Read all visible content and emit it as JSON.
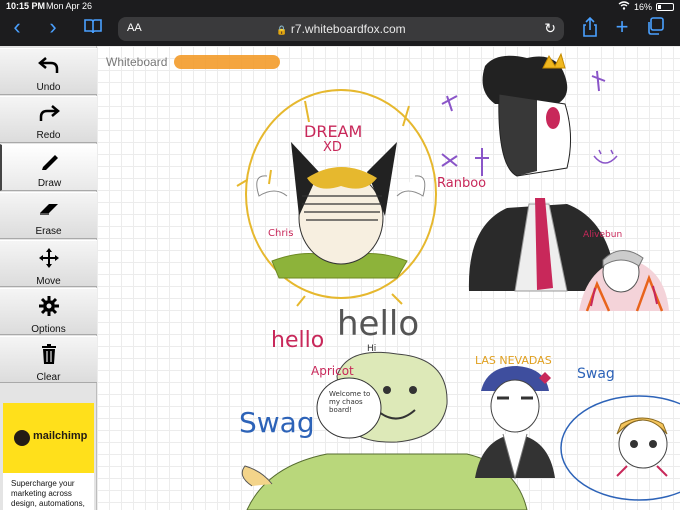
{
  "status_bar": {
    "time": "10:15 PM",
    "date": "Mon Apr 26",
    "battery": "16%"
  },
  "browser": {
    "aa_label": "AA",
    "url": "r7.whiteboardfox.com"
  },
  "toolbar": {
    "tools": [
      {
        "label": "Undo",
        "icon": "undo-icon"
      },
      {
        "label": "Redo",
        "icon": "redo-icon"
      },
      {
        "label": "Draw",
        "icon": "pencil-icon"
      },
      {
        "label": "Erase",
        "icon": "eraser-icon"
      },
      {
        "label": "Move",
        "icon": "move-icon"
      },
      {
        "label": "Options",
        "icon": "gear-icon"
      },
      {
        "label": "Clear",
        "icon": "trash-icon"
      }
    ],
    "active_tool": "Draw"
  },
  "ad": {
    "brand": "mailchimp",
    "copy": "Supercharge your marketing across design, automations,"
  },
  "canvas": {
    "title": "Whiteboard",
    "handwriting": {
      "dream": "DREAM",
      "xd": "XD",
      "ranboo": "Ranboo",
      "hello_pink": "hello",
      "hello_gray": "hello",
      "hi": "Hi",
      "apricot": "Apricot",
      "las_nevadas": "LAS NEVADAS",
      "swag_blue": "Swag",
      "swag_right": "Swag",
      "welcome": "Welcome to my chaos board!",
      "alivebun": "Alivebun",
      "chris": "Chris"
    }
  },
  "colors": {
    "safari_bar": "#1c1c1e",
    "link_blue": "#4aa0ff",
    "ad_yellow": "#ffe01b"
  }
}
